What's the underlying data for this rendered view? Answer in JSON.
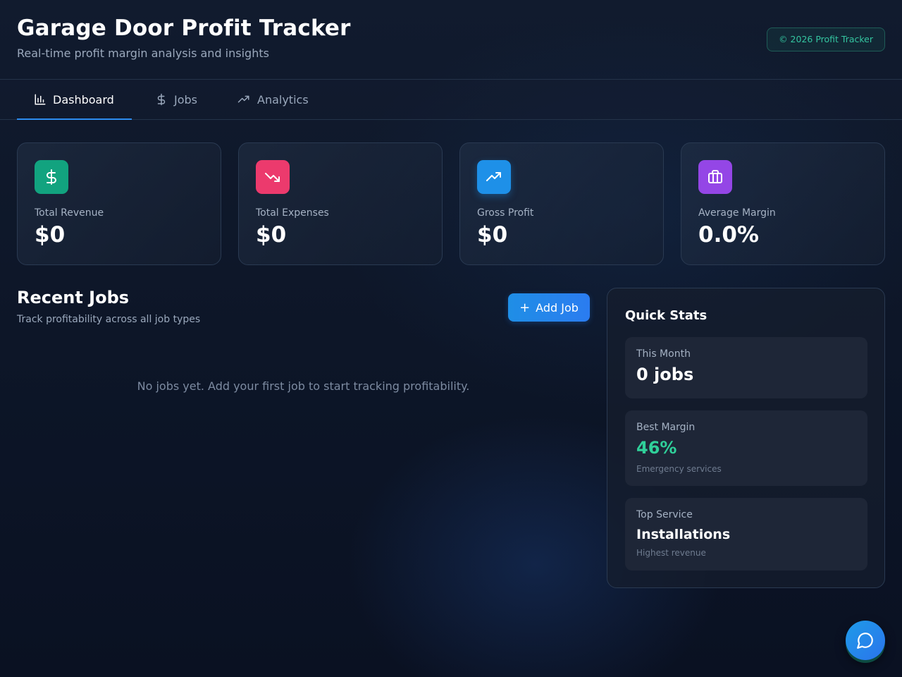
{
  "header": {
    "title": "Garage Door Profit Tracker",
    "subtitle": "Real-time profit margin analysis and insights",
    "badge": "© 2026 Profit Tracker"
  },
  "tabs": [
    {
      "label": "Dashboard",
      "icon": "bar-chart-icon",
      "active": true
    },
    {
      "label": "Jobs",
      "icon": "dollar-icon",
      "active": false
    },
    {
      "label": "Analytics",
      "icon": "trending-up-icon",
      "active": false
    }
  ],
  "stats": [
    {
      "label": "Total Revenue",
      "value": "$0",
      "icon": "dollar-icon",
      "color": "#12a37f"
    },
    {
      "label": "Total Expenses",
      "value": "$0",
      "icon": "trending-down-icon",
      "color": "#ec3a6d"
    },
    {
      "label": "Gross Profit",
      "value": "$0",
      "icon": "trending-up-icon",
      "color": "#1e90e8"
    },
    {
      "label": "Average Margin",
      "value": "0.0%",
      "icon": "briefcase-icon",
      "color": "#9446e6"
    }
  ],
  "recent_jobs": {
    "title": "Recent Jobs",
    "subtitle": "Track profitability across all job types",
    "add_button": "Add Job",
    "empty_message": "No jobs yet. Add your first job to start tracking profitability."
  },
  "quick_stats": {
    "title": "Quick Stats",
    "this_month": {
      "label": "This Month",
      "value": "0 jobs"
    },
    "best_margin": {
      "label": "Best Margin",
      "value": "46%",
      "note": "Emergency services",
      "color": "#2fd09a"
    },
    "top_service": {
      "label": "Top Service",
      "value": "Installations",
      "note": "Highest revenue"
    }
  },
  "chat_button": {
    "icon": "chat-bubble-icon"
  },
  "colors": {
    "accent": "#2d8cf0",
    "badge_text": "#34c5a0"
  }
}
